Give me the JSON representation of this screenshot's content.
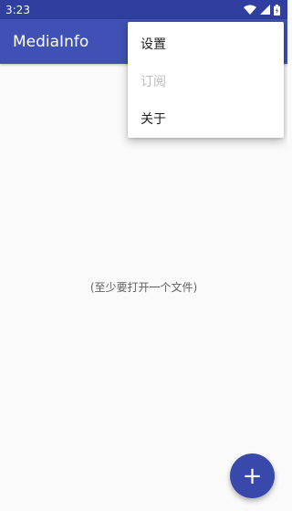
{
  "status_bar": {
    "time": "3:23",
    "icons": [
      "wifi-icon",
      "signal-icon",
      "battery-icon"
    ]
  },
  "app_bar": {
    "title": "MediaInfo"
  },
  "main": {
    "empty_message": "(至少要打开一个文件)"
  },
  "fab": {
    "icon": "add-icon",
    "label": "+"
  },
  "menu": {
    "items": [
      {
        "label": "设置",
        "enabled": true
      },
      {
        "label": "订阅",
        "enabled": false
      },
      {
        "label": "关于",
        "enabled": true
      }
    ]
  },
  "colors": {
    "status_bar": "#303f9f",
    "app_bar": "#3f51b5",
    "fab": "#3949ab",
    "background": "#fafafa"
  }
}
